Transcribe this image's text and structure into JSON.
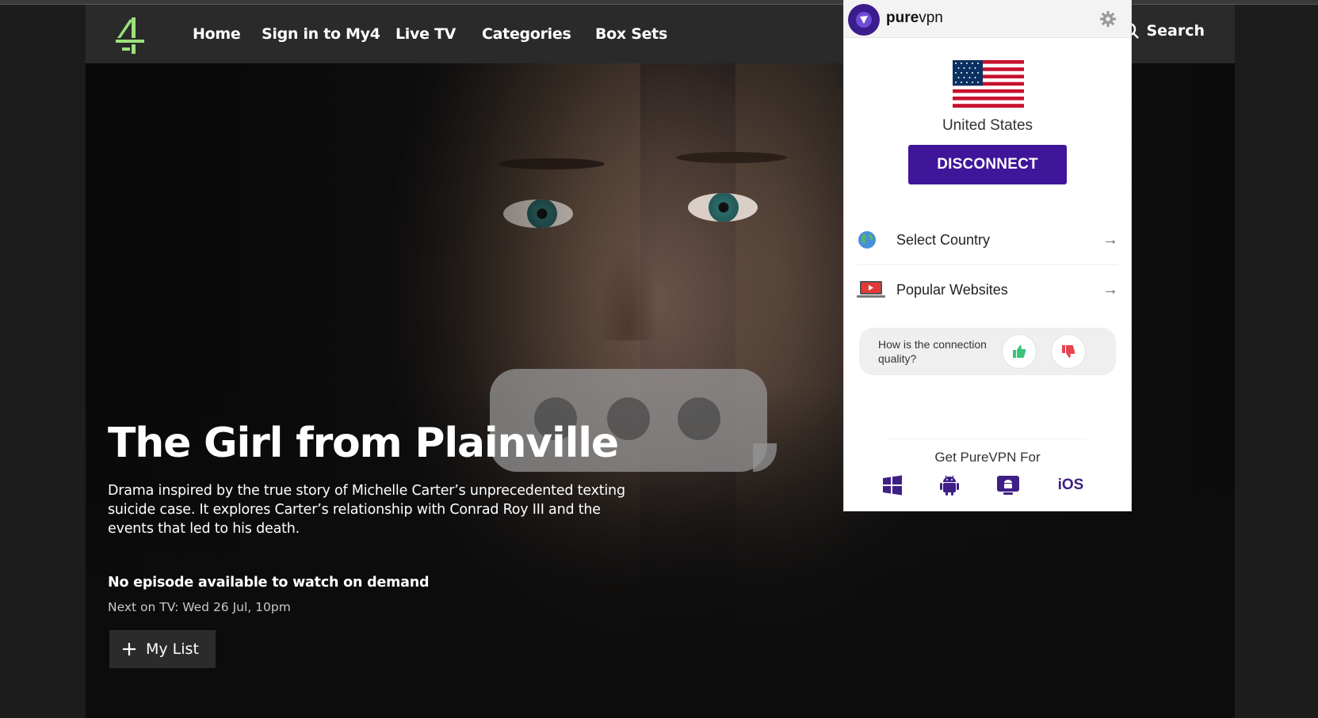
{
  "site": {
    "nav": {
      "home": "Home",
      "sign_in": "Sign in to My4",
      "live_tv": "Live TV",
      "categories": "Categories",
      "box_sets": "Box Sets",
      "search": "Search"
    },
    "hero": {
      "title": "The Girl from Plainville",
      "description": "Drama inspired by the true story of Michelle Carter’s unprecedented texting suicide case. It explores Carter’s relationship with Conrad Roy III and the events that led to his death.",
      "no_episode": "No episode available to watch on demand",
      "next_on_tv": "Next on TV: Wed 26 Jul, 10pm",
      "my_list": "My List"
    }
  },
  "vpn": {
    "brand_bold": "pure",
    "brand_light": "vpn",
    "country": "United States",
    "disconnect": "DISCONNECT",
    "menu": [
      {
        "label": "Select Country",
        "icon": "globe-icon"
      },
      {
        "label": "Popular Websites",
        "icon": "laptop-youtube-icon"
      }
    ],
    "feedback_question": "How is the connection quality?",
    "get_for": "Get PureVPN For",
    "platforms": [
      "windows-icon",
      "android-icon",
      "android-tv-icon",
      "iOS"
    ]
  },
  "colors": {
    "vpn_accent": "#3f1599",
    "c4_green": "#9be27c",
    "thumb_up": "#3cc27a",
    "thumb_down": "#e8454f"
  }
}
